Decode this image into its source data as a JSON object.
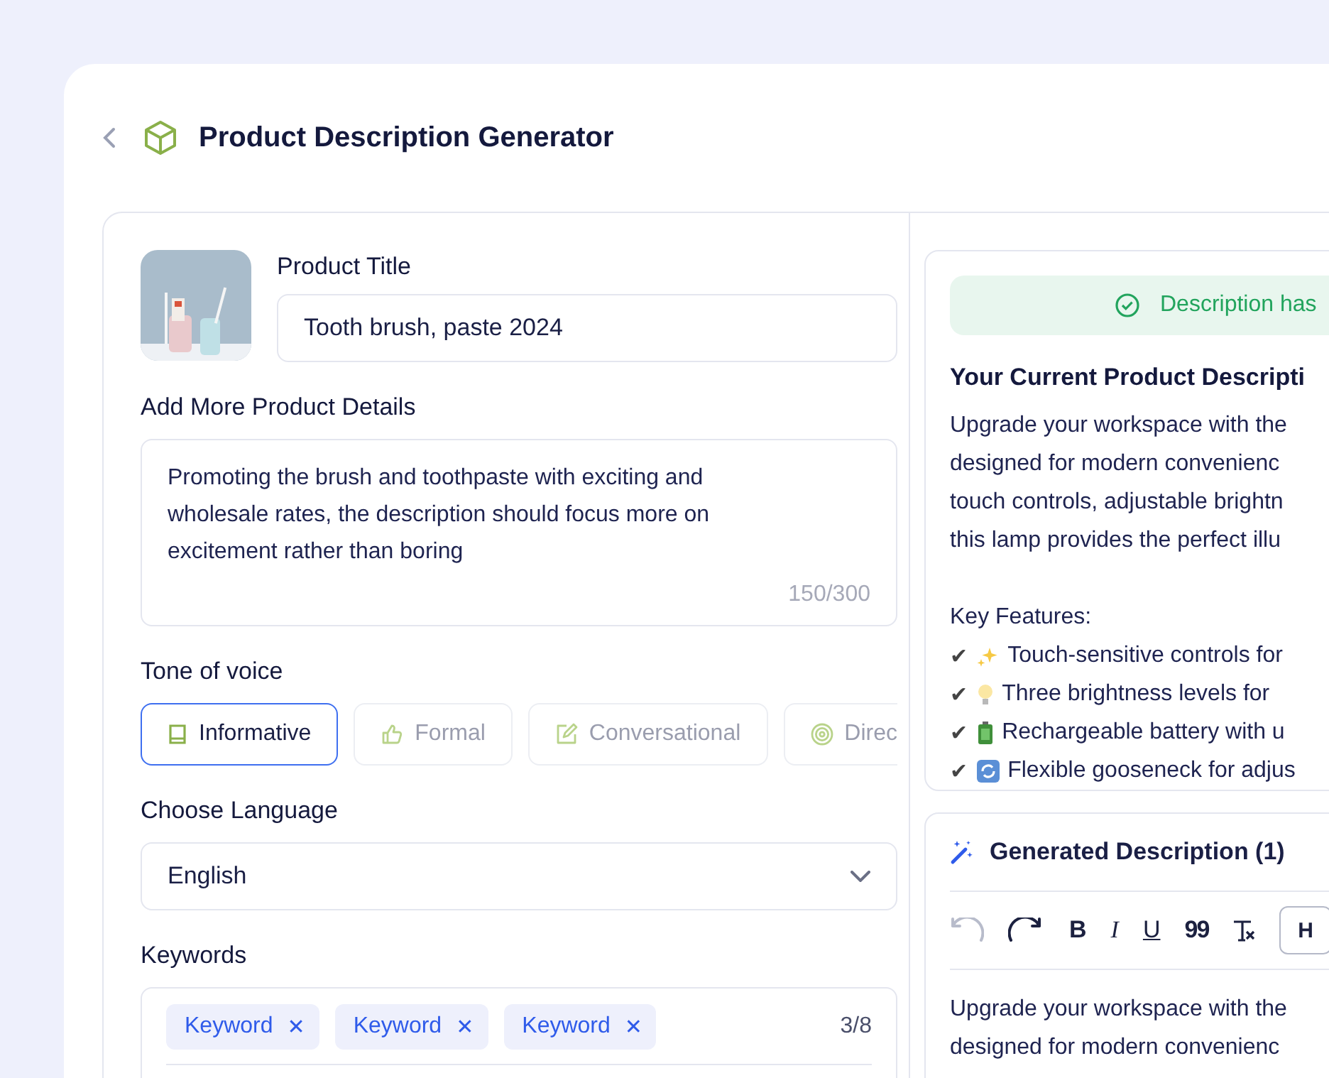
{
  "header": {
    "title": "Product Description Generator"
  },
  "form": {
    "product_title": {
      "label": "Product Title",
      "value": "Tooth brush, paste 2024"
    },
    "details": {
      "label": "Add More Product Details",
      "value": "Promoting the brush and toothpaste with exciting and wholesale rates, the description should focus more on excitement rather than boring",
      "counter": "150/300"
    },
    "tone": {
      "label": "Tone of voice",
      "options": [
        {
          "label": "Informative",
          "kind": "book",
          "selected": true
        },
        {
          "label": "Formal",
          "kind": "thumb",
          "selected": false
        },
        {
          "label": "Conversational",
          "kind": "pencil",
          "selected": false
        },
        {
          "label": "Direc",
          "kind": "target",
          "selected": false
        }
      ]
    },
    "language": {
      "label": "Choose Language",
      "value": "English"
    },
    "keywords": {
      "label": "Keywords",
      "chips": [
        "Keyword",
        "Keyword",
        "Keyword"
      ],
      "remove": "✕",
      "counter": "3/8"
    }
  },
  "current": {
    "banner": "Description has",
    "title": "Your Current Product Descripti",
    "lines": [
      "Upgrade your workspace with the",
      "designed for modern convenienc",
      "touch controls, adjustable brightn",
      "this lamp provides the perfect illu"
    ],
    "features_title": "Key Features:",
    "features": [
      {
        "mark": "✔",
        "kind": "sparkles",
        "text": "Touch-sensitive controls for"
      },
      {
        "mark": "✔",
        "kind": "bulb",
        "text": "Three brightness levels for"
      },
      {
        "mark": "✔",
        "kind": "battery",
        "text": "Rechargeable battery with u"
      },
      {
        "mark": "✔",
        "kind": "cycle",
        "text": "Flexible gooseneck for adjus"
      }
    ]
  },
  "generated": {
    "title": "Generated Description (1)",
    "toolbar": [
      {
        "kind": "undo",
        "disabled": true
      },
      {
        "kind": "redo",
        "disabled": false
      },
      {
        "kind": "bold",
        "label": "B",
        "disabled": false
      },
      {
        "kind": "italic",
        "label": "I",
        "disabled": false
      },
      {
        "kind": "underline",
        "label": "U",
        "disabled": false
      },
      {
        "kind": "quote",
        "label": "99",
        "disabled": false
      },
      {
        "kind": "clear",
        "disabled": false
      },
      {
        "kind": "heading",
        "label": "H",
        "disabled": false
      }
    ],
    "lines": [
      "Upgrade your workspace with the",
      "designed for modern convenienc"
    ]
  }
}
